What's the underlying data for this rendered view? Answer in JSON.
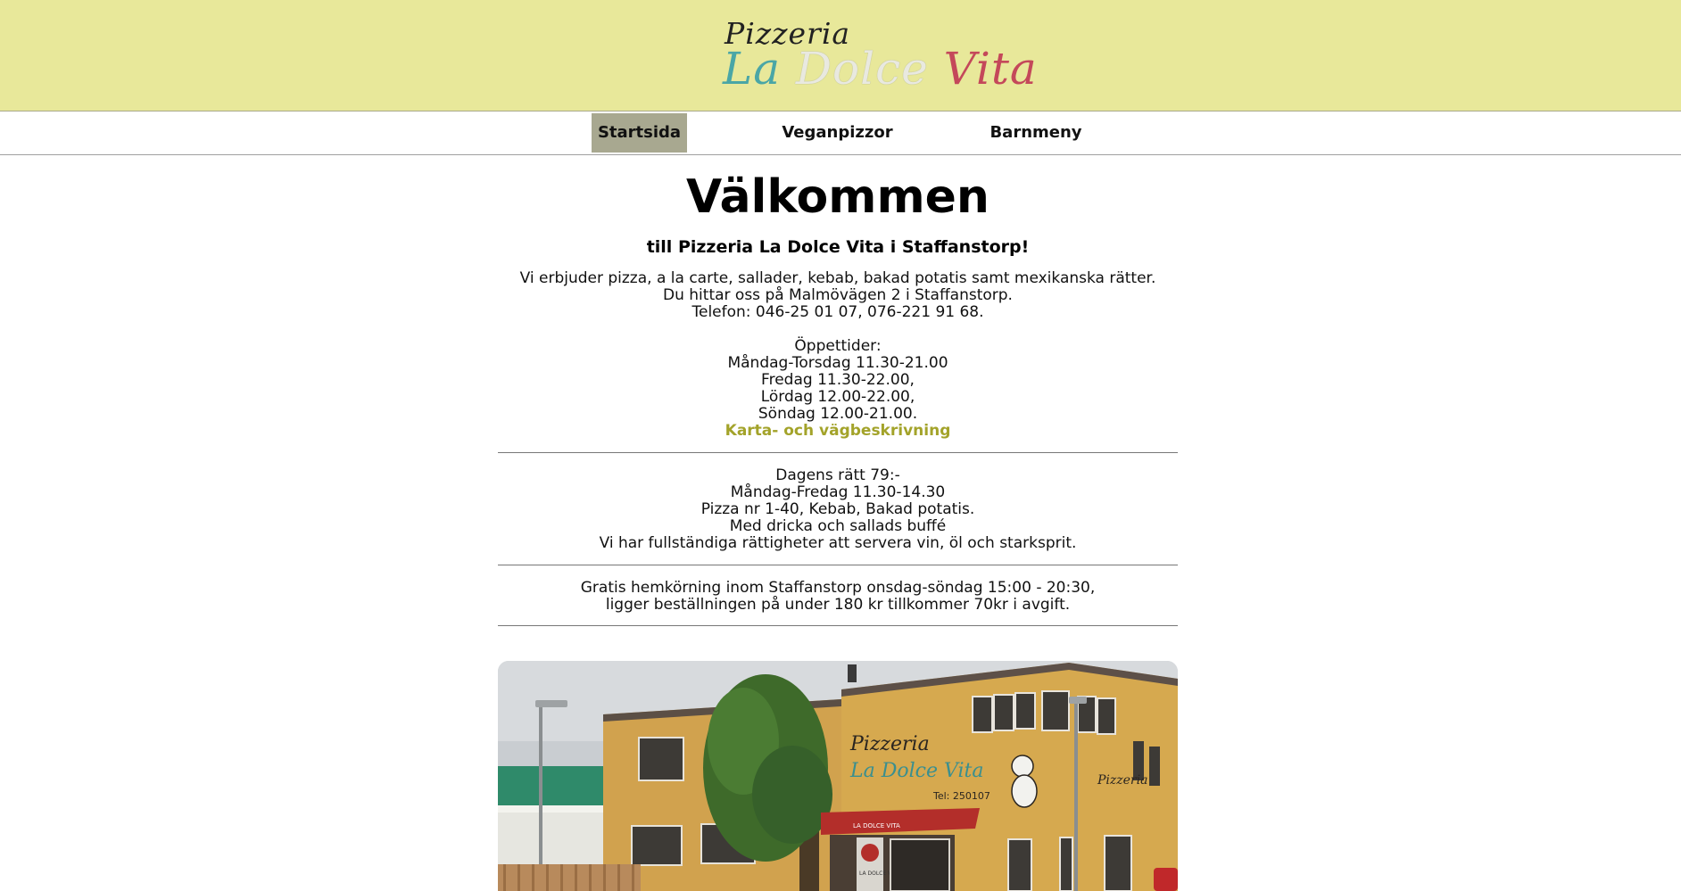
{
  "header": {
    "logo_small": "Pizzeria",
    "logo_word1": "La",
    "logo_word2": "Dolce",
    "logo_word3": "Vita"
  },
  "nav": {
    "items": [
      {
        "label": "Startsida",
        "active": true
      },
      {
        "label": "Veganpizzor",
        "active": false
      },
      {
        "label": "Barnmeny",
        "active": false
      }
    ]
  },
  "main": {
    "title": "Välkommen",
    "subtitle": "till Pizzeria La Dolce Vita i Staffanstorp!",
    "intro": [
      "Vi erbjuder pizza, a la carte, sallader, kebab, bakad potatis samt mexikanska rätter.",
      "Du hittar oss på Malmövägen 2 i Staffanstorp.",
      "Telefon: 046-25 01 07, 076-221 91 68."
    ],
    "hours_heading": "Öppettider:",
    "hours": [
      "Måndag-Torsdag 11.30-21.00",
      "Fredag 11.30-22.00,",
      "Lördag 12.00-22.00,",
      "Söndag 12.00-21.00."
    ],
    "map_link": "Karta- och vägbeskrivning",
    "lunch": [
      "Dagens rätt 79:-",
      "Måndag-Fredag 11.30-14.30",
      "Pizza nr 1-40, Kebab, Bakad potatis.",
      "Med dricka och sallads buffé",
      "Vi har fullständiga rättigheter att servera vin, öl och starksprit."
    ],
    "delivery": [
      "Gratis hemkörning inom Staffanstorp onsdag-söndag 15:00 - 20:30,",
      "ligger beställningen på under 180 kr tillkommer 70kr i avgift."
    ],
    "photo_sign_small": "Pizzeria",
    "photo_sign_big": "La Dolce Vita",
    "photo_sign_tel": "Tel: 250107",
    "photo_awning_text": "LA DOLCE VITA",
    "photo_door_text": "LA DOLCE VITA"
  },
  "colors": {
    "header_bg": "#e8e89a",
    "nav_active_bg": "#a8a890",
    "link": "#a3a32a",
    "logo_teal": "#4aa6a6",
    "logo_red": "#c4485a"
  }
}
